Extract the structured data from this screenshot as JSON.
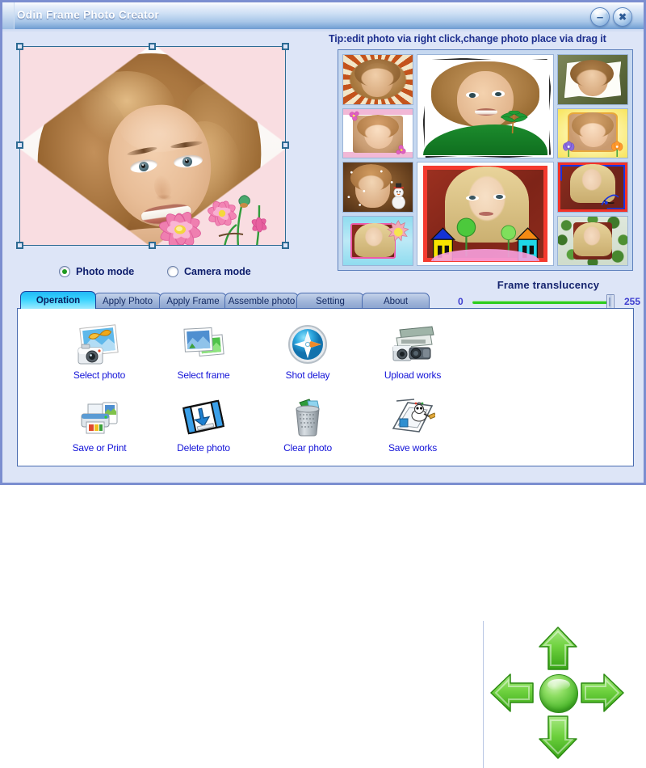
{
  "window": {
    "title": "Odin Frame Photo Creator",
    "border_color": "#7b8ed0",
    "background_color": "#dde5f7",
    "titlebar_buttons": [
      {
        "name": "minimize-button",
        "glyph": "–"
      },
      {
        "name": "close-button",
        "glyph": "✖"
      }
    ]
  },
  "tip": {
    "text": "Tip:edit photo via right click,change photo place via drag it",
    "color": "#1d2f8e"
  },
  "canvas": {
    "name": "photo-canvas",
    "selection_handles": 8,
    "frame_overlay": "pink-diagonal-corners",
    "handle_color": "#2d6b94"
  },
  "modes": {
    "options": [
      {
        "label": "Photo mode",
        "selected": true
      },
      {
        "label": "Camera mode",
        "selected": false
      }
    ],
    "selected_color": "#1f9a1f"
  },
  "translucency": {
    "title": "Frame translucency",
    "min_label": "0",
    "max_label": "255",
    "value": 255,
    "track_color": "#2fcc22"
  },
  "thumbnails": {
    "cells": [
      {
        "name": "thumb-1",
        "style": "orange-mosaic-frame",
        "subject": "brunette-portrait"
      },
      {
        "name": "thumb-big-1",
        "style": "torn-paper-green-hill-frame",
        "subject": "brunette-portrait"
      },
      {
        "name": "thumb-2",
        "style": "olive-green-torn-frame",
        "subject": "brunette-portrait"
      },
      {
        "name": "thumb-3",
        "style": "pink-flowers-frame",
        "subject": "blonde-portrait"
      },
      {
        "name": "thumb-4",
        "style": "yellow-tulip-frame",
        "subject": "blonde-portrait"
      },
      {
        "name": "thumb-5",
        "style": "brown-snowman-winter-frame",
        "subject": "blonde-portrait"
      },
      {
        "name": "thumb-big-2",
        "style": "red-brush-house-tree-frame",
        "subject": "blonde-portrait",
        "selected": true
      },
      {
        "name": "thumb-6",
        "style": "red-blue-doodle-frame",
        "subject": "blonde-portrait"
      },
      {
        "name": "thumb-7",
        "style": "cyan-pink-sun-frame",
        "subject": "blonde-portrait"
      },
      {
        "name": "thumb-8",
        "style": "green-leaf-frame",
        "subject": "blonde-portrait"
      }
    ]
  },
  "tabs": [
    {
      "label": "Operation",
      "active": true
    },
    {
      "label": "Apply Photo",
      "active": false
    },
    {
      "label": "Apply Frame",
      "active": false
    },
    {
      "label": "Assemble photo",
      "active": false
    },
    {
      "label": "Setting",
      "active": false
    },
    {
      "label": "About",
      "active": false
    }
  ],
  "operations": [
    {
      "label": "Select photo",
      "icon": "photo-with-butterfly-camera-icon"
    },
    {
      "label": "Select frame",
      "icon": "picture-frame-stack-icon"
    },
    {
      "label": "Shot delay",
      "icon": "compass-timer-icon"
    },
    {
      "label": "Upload works",
      "icon": "upload-scanner-icon"
    },
    {
      "label": "Save or Print",
      "icon": "printer-icon"
    },
    {
      "label": "Delete photo",
      "icon": "floppy-down-arrow-icon"
    },
    {
      "label": "Clear photo",
      "icon": "trash-bin-icon"
    },
    {
      "label": "Save works",
      "icon": "desk-save-icon"
    }
  ],
  "dpad": {
    "buttons": [
      {
        "name": "move-up-button",
        "direction": "up"
      },
      {
        "name": "move-left-button",
        "direction": "left"
      },
      {
        "name": "center-button",
        "direction": "center"
      },
      {
        "name": "move-right-button",
        "direction": "right"
      },
      {
        "name": "move-down-button",
        "direction": "down"
      }
    ],
    "color": "#4cb82c"
  }
}
